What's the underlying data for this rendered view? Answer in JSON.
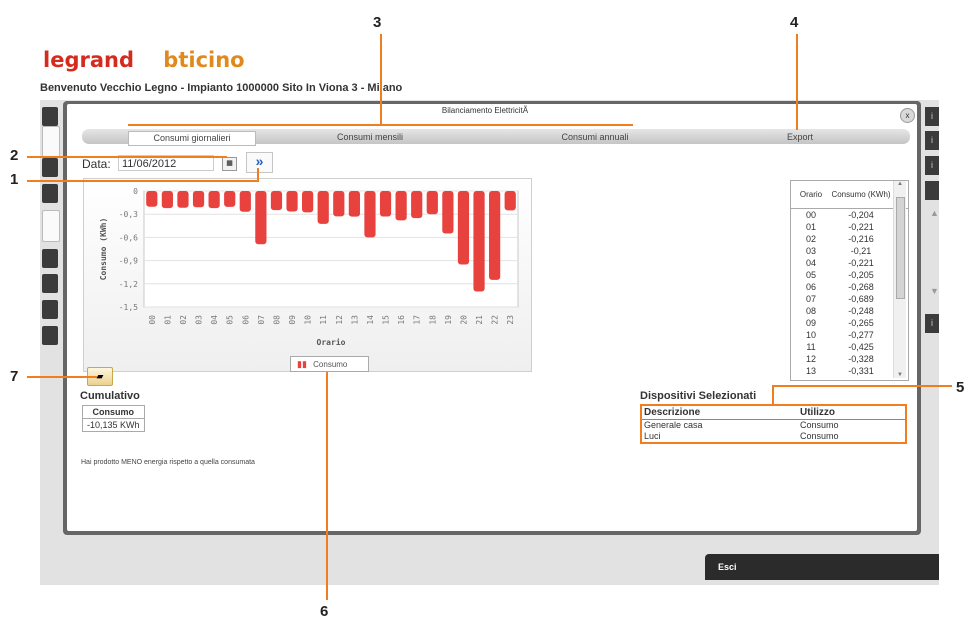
{
  "brand": {
    "logo1": "legrand",
    "logo2": "bticino"
  },
  "welcome_text": "Benvenuto Vecchio Legno - Impianto 1000000 Sito In Viona 3 - Milano",
  "dialog": {
    "title": "Bilanciamento ElettricitÃ",
    "close_label": "x"
  },
  "tabs": [
    "Consumi giornalieri",
    "Consumi mensili",
    "Consumi annuali",
    "Export"
  ],
  "date": {
    "label": "Data:",
    "value": "11/06/2012"
  },
  "icons": {
    "calendar": "calendar-icon",
    "next": "double-chevron-right-icon",
    "export": "folder-icon",
    "legend": "bar-chart-icon"
  },
  "chart_data": {
    "type": "bar",
    "xlabel": "Orario",
    "ylabel": "Consumo (KWh)",
    "ylim": [
      -1.5,
      0
    ],
    "yticks": [
      "0",
      "-0,3",
      "-0,6",
      "-0,9",
      "-1,2",
      "-1,5"
    ],
    "categories": [
      "00",
      "01",
      "02",
      "03",
      "04",
      "05",
      "06",
      "07",
      "08",
      "09",
      "10",
      "11",
      "12",
      "13",
      "14",
      "15",
      "16",
      "17",
      "18",
      "19",
      "20",
      "21",
      "22",
      "23"
    ],
    "series": [
      {
        "name": "Consumo",
        "color": "#e8423f",
        "values": [
          -0.204,
          -0.221,
          -0.216,
          -0.21,
          -0.221,
          -0.205,
          -0.268,
          -0.689,
          -0.248,
          -0.265,
          -0.277,
          -0.425,
          -0.328,
          -0.331,
          -0.6,
          -0.33,
          -0.38,
          -0.35,
          -0.3,
          -0.55,
          -0.95,
          -1.3,
          -1.15,
          -0.25
        ]
      }
    ],
    "grid": true,
    "legend": "bottom"
  },
  "table": {
    "headers": [
      "Orario",
      "Consumo (KWh)"
    ],
    "rows": [
      [
        "00",
        "-0,204"
      ],
      [
        "01",
        "-0,221"
      ],
      [
        "02",
        "-0,216"
      ],
      [
        "03",
        "-0,21"
      ],
      [
        "04",
        "-0,221"
      ],
      [
        "05",
        "-0,205"
      ],
      [
        "06",
        "-0,268"
      ],
      [
        "07",
        "-0,689"
      ],
      [
        "08",
        "-0,248"
      ],
      [
        "09",
        "-0,265"
      ],
      [
        "10",
        "-0,277"
      ],
      [
        "11",
        "-0,425"
      ],
      [
        "12",
        "-0,328"
      ],
      [
        "13",
        "-0,331"
      ]
    ]
  },
  "cumulativo": {
    "title": "Cumulativo",
    "header": "Consumo",
    "value": "-10,135 KWh"
  },
  "note": "Hai prodotto MENO energia rispetto a quella consumata",
  "devices": {
    "title": "Dispositivi Selezionati",
    "headers": [
      "Descrizione",
      "Utilizzo"
    ],
    "rows": [
      [
        "Generale casa",
        "Consumo"
      ],
      [
        "Luci",
        "Consumo"
      ]
    ]
  },
  "exit_label": "Esci",
  "callouts": [
    "1",
    "2",
    "3",
    "4",
    "5",
    "6",
    "7"
  ],
  "colors": {
    "accent": "#f07d1f",
    "bar": "#e8423f",
    "legrand": "#d52b1e",
    "bticino": "#e08a1e"
  }
}
